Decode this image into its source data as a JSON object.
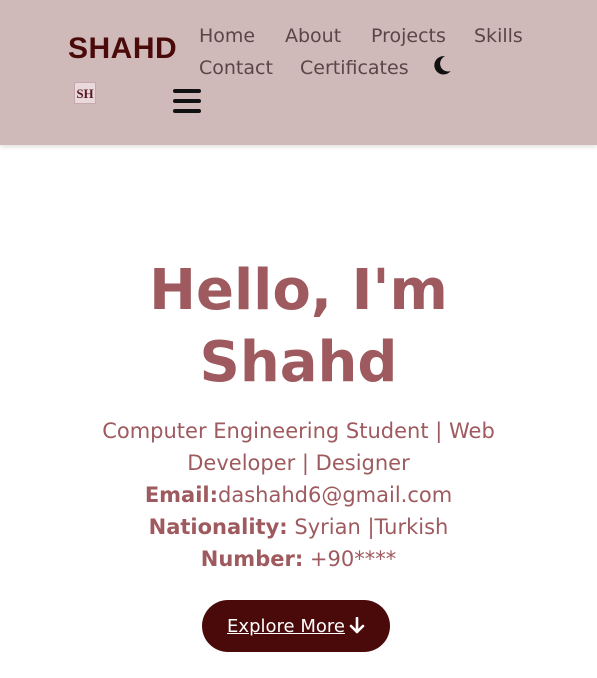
{
  "header": {
    "brand": "SHAHD",
    "logo_text": "SH",
    "nav": [
      "Home",
      "About",
      "Projects",
      "Skills",
      "Contact",
      "Certificates"
    ],
    "theme_icon": "moon-icon",
    "menu_icon": "hamburger-icon"
  },
  "hero": {
    "title_line1": "Hello, I'm",
    "title_line2": "Shahd",
    "subtitle": "Computer Engineering Student | Web Developer | Designer",
    "email_label": "Email:",
    "email_value": "dashahd6@gmail.com",
    "nationality_label": "Nationality:",
    "nationality_value": " Syrian |Turkish",
    "number_label": "Number:",
    "number_value": " +90****",
    "cta_label": "Explore More ",
    "cta_icon": "arrow-down-icon"
  },
  "colors": {
    "header_bg": "#d0b9b9",
    "brand": "#4a0a0a",
    "accent_text": "#9e5a5e",
    "button_bg": "#4a0a0a"
  }
}
